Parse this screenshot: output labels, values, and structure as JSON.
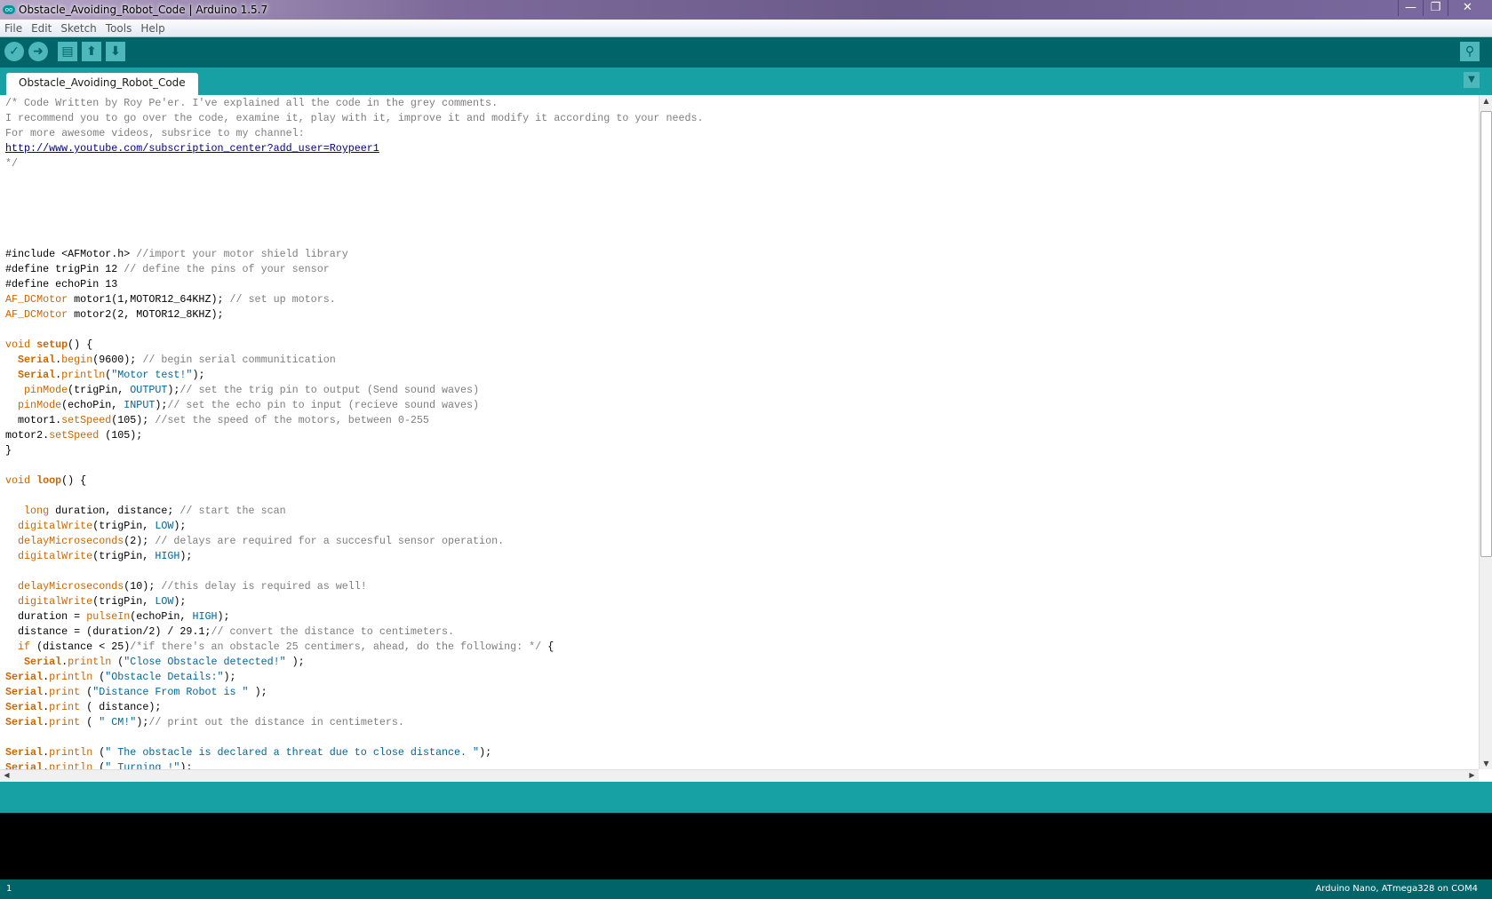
{
  "window": {
    "title": "Obstacle_Avoiding_Robot_Code | Arduino 1.5.7",
    "logo": "oo",
    "minimize": "—",
    "restore": "❐",
    "close": "✕"
  },
  "menu": [
    "File",
    "Edit",
    "Sketch",
    "Tools",
    "Help"
  ],
  "toolbar": {
    "verify_icon": "✓",
    "upload_icon": "➜",
    "new_icon": "▤",
    "open_icon": "⬆",
    "save_icon": "⬇",
    "serial_monitor_icon": "⚲"
  },
  "tab": {
    "label": "Obstacle_Avoiding_Robot_Code",
    "menu_icon": "▼"
  },
  "code_lines": [
    [
      [
        "/* Code Written by Roy Pe'er. I've explained all the code in the grey comments.",
        "c"
      ]
    ],
    [
      [
        "I recommend you to go over the code, examine it, play with it, improve it and modify it according to your needs.",
        "c"
      ]
    ],
    [
      [
        "For more awesome videos, subsrice to my channel:",
        "c"
      ]
    ],
    [
      [
        "http://www.youtube.com/subscription_center?add_user=Roypeer1",
        "l"
      ]
    ],
    [
      [
        "*/",
        "c"
      ]
    ],
    [],
    [],
    [],
    [],
    [],
    [
      [
        "#include <AFMotor.h> ",
        ""
      ],
      [
        "//import your motor shield library",
        "c"
      ]
    ],
    [
      [
        "#define trigPin 12 ",
        ""
      ],
      [
        "// define the pins of your sensor",
        "c"
      ]
    ],
    [
      [
        "#define echoPin 13",
        ""
      ]
    ],
    [
      [
        "AF_DCMotor",
        "k"
      ],
      [
        " motor1(1,MOTOR12_64KHZ); ",
        ""
      ],
      [
        "// set up motors.",
        "c"
      ]
    ],
    [
      [
        "AF_DCMotor",
        "k"
      ],
      [
        " motor2(2, MOTOR12_8KHZ);",
        ""
      ]
    ],
    [],
    [
      [
        "void",
        "k"
      ],
      [
        " ",
        ""
      ],
      [
        "setup",
        "kb"
      ],
      [
        "() {",
        ""
      ]
    ],
    [
      [
        "  ",
        ""
      ],
      [
        "Serial",
        "kb"
      ],
      [
        ".",
        ""
      ],
      [
        "begin",
        "k"
      ],
      [
        "(9600); ",
        ""
      ],
      [
        "// begin serial communitication",
        "c"
      ]
    ],
    [
      [
        "  ",
        ""
      ],
      [
        "Serial",
        "kb"
      ],
      [
        ".",
        ""
      ],
      [
        "println",
        "k"
      ],
      [
        "(",
        ""
      ],
      [
        "\"Motor test!\"",
        "s"
      ],
      [
        ");",
        ""
      ]
    ],
    [
      [
        "   ",
        ""
      ],
      [
        "pinMode",
        "k"
      ],
      [
        "(trigPin, ",
        ""
      ],
      [
        "OUTPUT",
        "b"
      ],
      [
        ");",
        ""
      ],
      [
        "// set the trig pin to output (Send sound waves)",
        "c"
      ]
    ],
    [
      [
        "  ",
        ""
      ],
      [
        "pinMode",
        "k"
      ],
      [
        "(echoPin, ",
        ""
      ],
      [
        "INPUT",
        "b"
      ],
      [
        ");",
        ""
      ],
      [
        "// set the echo pin to input (recieve sound waves)",
        "c"
      ]
    ],
    [
      [
        "  motor1.",
        ""
      ],
      [
        "setSpeed",
        "k"
      ],
      [
        "(105); ",
        ""
      ],
      [
        "//set the speed of the motors, between 0-255",
        "c"
      ]
    ],
    [
      [
        "motor2.",
        ""
      ],
      [
        "setSpeed",
        "k"
      ],
      [
        " (105);",
        ""
      ]
    ],
    [
      [
        "}",
        ""
      ]
    ],
    [],
    [
      [
        "void",
        "k"
      ],
      [
        " ",
        ""
      ],
      [
        "loop",
        "kb"
      ],
      [
        "() {",
        ""
      ]
    ],
    [],
    [
      [
        "   ",
        ""
      ],
      [
        "long",
        "k"
      ],
      [
        " duration, distance; ",
        ""
      ],
      [
        "// start the scan",
        "c"
      ]
    ],
    [
      [
        "  ",
        ""
      ],
      [
        "digitalWrite",
        "k"
      ],
      [
        "(trigPin, ",
        ""
      ],
      [
        "LOW",
        "b"
      ],
      [
        ");",
        ""
      ]
    ],
    [
      [
        "  ",
        ""
      ],
      [
        "delayMicroseconds",
        "k"
      ],
      [
        "(2); ",
        ""
      ],
      [
        "// delays are required for a succesful sensor operation.",
        "c"
      ]
    ],
    [
      [
        "  ",
        ""
      ],
      [
        "digitalWrite",
        "k"
      ],
      [
        "(trigPin, ",
        ""
      ],
      [
        "HIGH",
        "b"
      ],
      [
        ");",
        ""
      ]
    ],
    [],
    [
      [
        "  ",
        ""
      ],
      [
        "delayMicroseconds",
        "k"
      ],
      [
        "(10); ",
        ""
      ],
      [
        "//this delay is required as well!",
        "c"
      ]
    ],
    [
      [
        "  ",
        ""
      ],
      [
        "digitalWrite",
        "k"
      ],
      [
        "(trigPin, ",
        ""
      ],
      [
        "LOW",
        "b"
      ],
      [
        ");",
        ""
      ]
    ],
    [
      [
        "  duration = ",
        ""
      ],
      [
        "pulseIn",
        "k"
      ],
      [
        "(echoPin, ",
        ""
      ],
      [
        "HIGH",
        "b"
      ],
      [
        ");",
        ""
      ]
    ],
    [
      [
        "  distance = (duration/2) / 29.1;",
        ""
      ],
      [
        "// convert the distance to centimeters.",
        "c"
      ]
    ],
    [
      [
        "  ",
        ""
      ],
      [
        "if",
        "k"
      ],
      [
        " (distance < 25)",
        ""
      ],
      [
        "/*if there's an obstacle 25 centimers, ahead, do the following: */",
        "c"
      ],
      [
        " {",
        ""
      ]
    ],
    [
      [
        "   ",
        ""
      ],
      [
        "Serial",
        "kb"
      ],
      [
        ".",
        ""
      ],
      [
        "println",
        "k"
      ],
      [
        " (",
        ""
      ],
      [
        "\"Close Obstacle detected!\"",
        "s"
      ],
      [
        " );",
        ""
      ]
    ],
    [
      [
        "Serial",
        "kb"
      ],
      [
        ".",
        ""
      ],
      [
        "println",
        "k"
      ],
      [
        " (",
        ""
      ],
      [
        "\"Obstacle Details:\"",
        "s"
      ],
      [
        ");",
        ""
      ]
    ],
    [
      [
        "Serial",
        "kb"
      ],
      [
        ".",
        ""
      ],
      [
        "print",
        "k"
      ],
      [
        " (",
        ""
      ],
      [
        "\"Distance From Robot is \"",
        "s"
      ],
      [
        " );",
        ""
      ]
    ],
    [
      [
        "Serial",
        "kb"
      ],
      [
        ".",
        ""
      ],
      [
        "print",
        "k"
      ],
      [
        " ( distance);",
        ""
      ]
    ],
    [
      [
        "Serial",
        "kb"
      ],
      [
        ".",
        ""
      ],
      [
        "print",
        "k"
      ],
      [
        " ( ",
        ""
      ],
      [
        "\" CM!\"",
        "s"
      ],
      [
        ");",
        ""
      ],
      [
        "// print out the distance in centimeters.",
        "c"
      ]
    ],
    [],
    [
      [
        "Serial",
        "kb"
      ],
      [
        ".",
        ""
      ],
      [
        "println",
        "k"
      ],
      [
        " (",
        ""
      ],
      [
        "\" The obstacle is declared a threat due to close distance. \"",
        "s"
      ],
      [
        ");",
        ""
      ]
    ],
    [
      [
        "Serial",
        "kb"
      ],
      [
        ".",
        ""
      ],
      [
        "println",
        "k"
      ],
      [
        " (",
        ""
      ],
      [
        "\" Turning !\"",
        "s"
      ],
      [
        ");",
        ""
      ]
    ]
  ],
  "status": {
    "line_number": "1",
    "board": "Arduino Nano, ATmega328 on COM4"
  }
}
